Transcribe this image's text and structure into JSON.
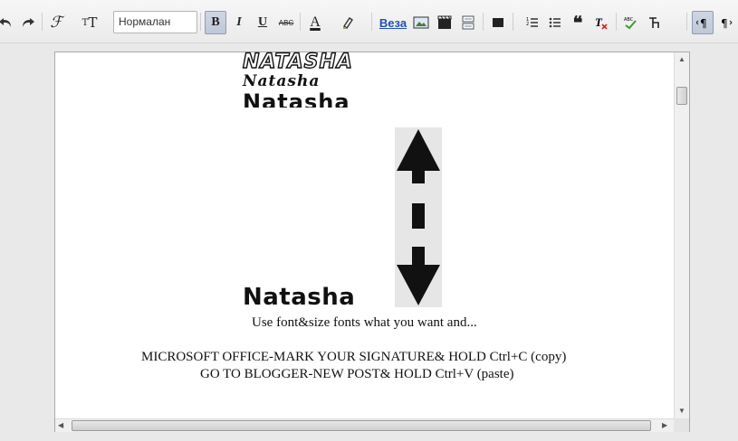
{
  "toolbar": {
    "format_select_value": "Нормалан",
    "bold_label": "B",
    "italic_label": "I",
    "underline_label": "U",
    "strike_label": "ABC",
    "text_color_label": "A",
    "link_label": "Веза"
  },
  "editor": {
    "signatures": [
      "Natasha",
      "Natasha",
      "Natasha",
      "Natasha"
    ],
    "line_hint": "Use font&size fonts what you want and...",
    "line_office": "MICROSOFT OFFICE-MARK YOUR SIGNATURE& HOLD Ctrl+C (copy)",
    "line_blogger": "GO TO BLOGGER-NEW POST& HOLD Ctrl+V (paste)"
  },
  "colors": {
    "link_blue": "#2050b8",
    "active_button": "#bfc8d9"
  }
}
